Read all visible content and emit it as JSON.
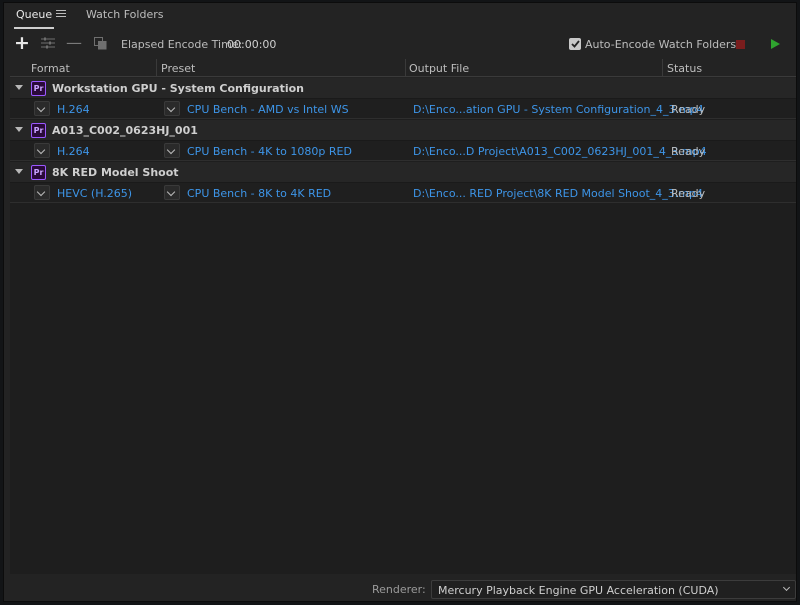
{
  "tabs": [
    {
      "label": "Queue",
      "active": true
    },
    {
      "label": "Watch Folders",
      "active": false
    }
  ],
  "toolbar": {
    "elapsed_label": "Elapsed Encode Time:",
    "elapsed_value": "00:00:00",
    "auto_encode_label": "Auto-Encode Watch Folders",
    "auto_encode_checked": true
  },
  "columns": {
    "format": "Format",
    "preset": "Preset",
    "output": "Output File",
    "status": "Status"
  },
  "queue": [
    {
      "source": "Workstation GPU - System Configuration",
      "badge": "Pr",
      "format": "H.264",
      "preset": "CPU Bench - AMD vs Intel WS",
      "output": "D:\\Enco...ation GPU - System Configuration_4_3.mp4",
      "status": "Ready"
    },
    {
      "source": "A013_C002_0623HJ_001",
      "badge": "Pr",
      "format": "H.264",
      "preset": "CPU Bench - 4K to 1080p RED",
      "output": "D:\\Enco...D Project\\A013_C002_0623HJ_001_4_3.mp4",
      "status": "Ready"
    },
    {
      "source": "8K RED Model Shoot",
      "badge": "Pr",
      "format": "HEVC (H.265)",
      "preset": "CPU Bench - 8K to 4K RED",
      "output": "D:\\Enco... RED Project\\8K RED Model Shoot_4_3.mp4",
      "status": "Ready"
    }
  ],
  "footer": {
    "renderer_label": "Renderer:",
    "renderer_value": "Mercury Playback Engine GPU Acceleration (CUDA)"
  },
  "colors": {
    "link": "#3d95e8",
    "badge_border": "#9b58ff",
    "play": "#2fa32f",
    "stop": "#7a1d1d"
  }
}
